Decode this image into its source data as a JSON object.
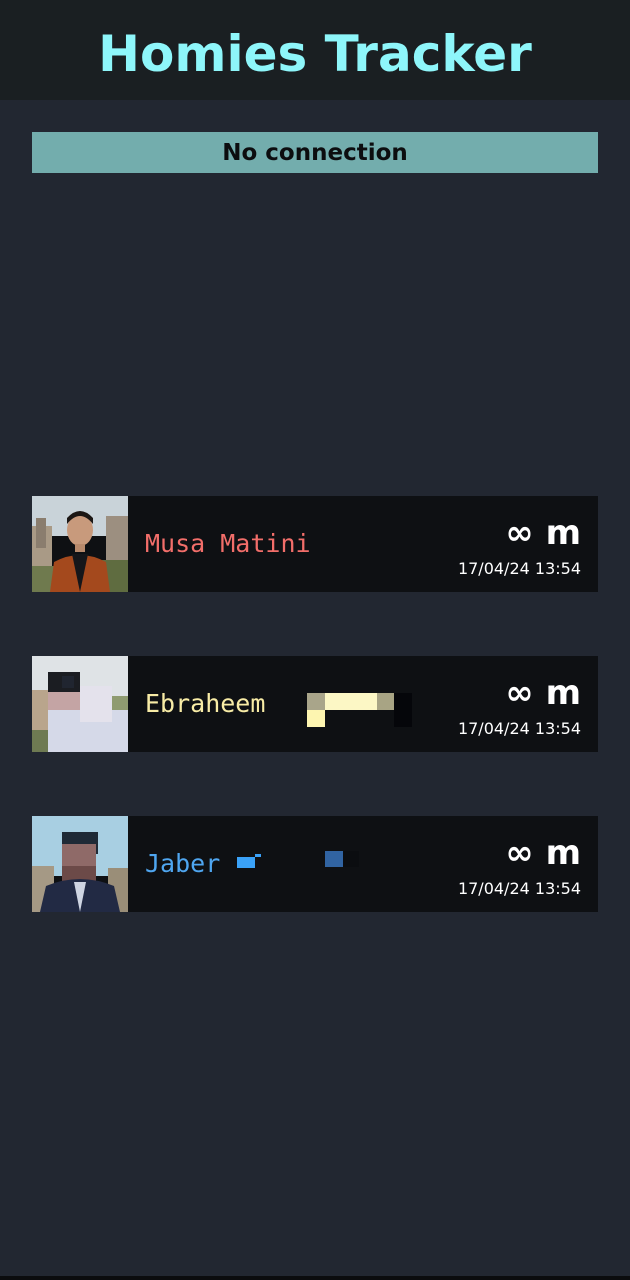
{
  "header": {
    "title": "Homies Tracker"
  },
  "status": {
    "banner_text": "No connection"
  },
  "homies": [
    {
      "name": "Musa Matini",
      "name_color": "#f26e6a",
      "distance": "∞ m",
      "timestamp": "17/04/24 13:54",
      "avatar_icon": "profile-photo"
    },
    {
      "name": "Ebraheem",
      "name_color": "#f8eca6",
      "distance": "∞ m",
      "timestamp": "17/04/24 13:54",
      "avatar_icon": "profile-photo"
    },
    {
      "name": "Jaber",
      "name_color": "#4fa6f0",
      "distance": "∞ m",
      "timestamp": "17/04/24 13:54",
      "avatar_icon": "profile-photo"
    }
  ],
  "colors": {
    "background": "#222731",
    "header_bg": "#1a1f22",
    "title": "#8ef6fa",
    "banner_bg": "#73adad",
    "card_bg": "#0e1013"
  }
}
